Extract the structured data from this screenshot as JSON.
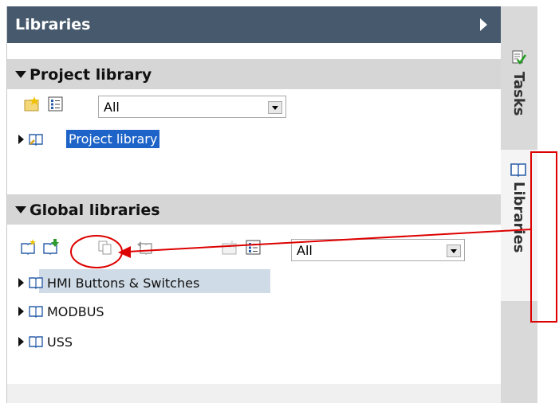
{
  "panel": {
    "title": "Libraries"
  },
  "project_library": {
    "header": "Project library",
    "filter_value": "All",
    "tree_item": "Project library"
  },
  "global_libraries": {
    "header": "Global libraries",
    "filter_value": "All",
    "items": [
      "HMI Buttons & Switches",
      "MODBUS",
      "USS"
    ]
  },
  "side_tabs": {
    "tasks": "Tasks",
    "libraries": "Libraries"
  },
  "annotation_color": "#dd0000"
}
